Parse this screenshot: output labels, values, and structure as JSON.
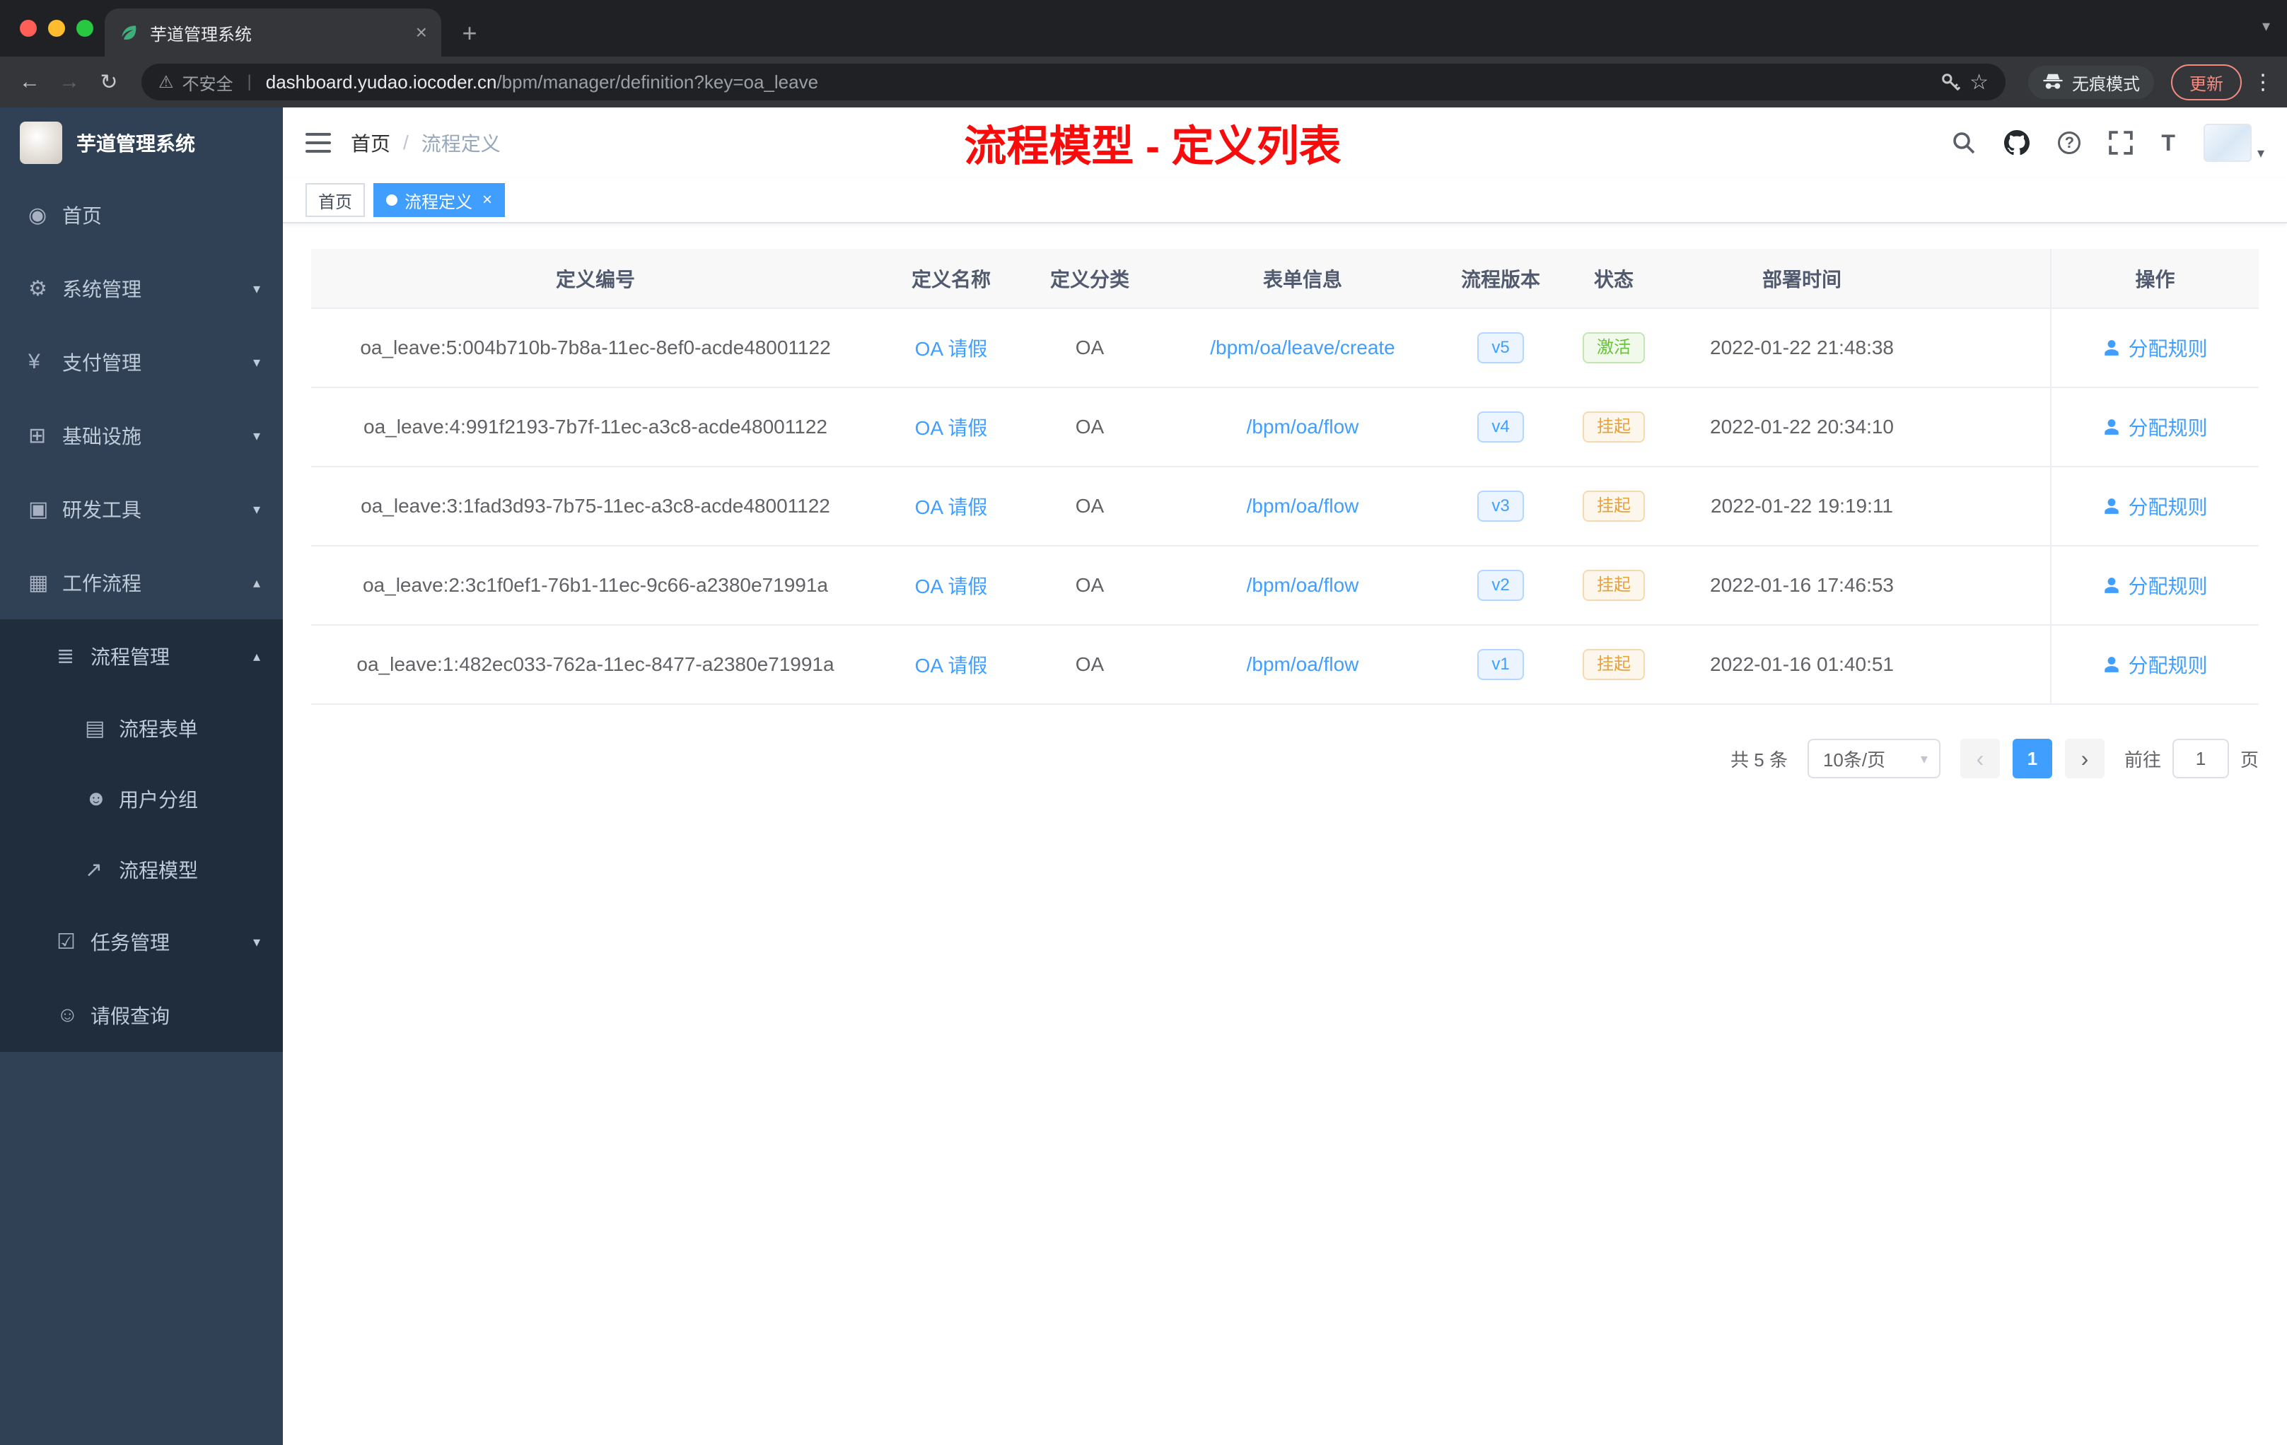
{
  "colors": {
    "accent": "#409eff",
    "annotation": "#f70b0b",
    "success": "#67c23a",
    "warning": "#e6a23c"
  },
  "icons": {
    "back": "←",
    "forward": "→",
    "reload": "↻",
    "warning": "⚠",
    "star": "☆",
    "dots": "⋮",
    "plus": "+",
    "close": "×",
    "caret_down": "▾",
    "caret_up": "▴",
    "divider": "|",
    "dashboard": "◉",
    "gear": "⚙",
    "payment": "¥",
    "infrastructure": "⊞",
    "devtools": "▣",
    "workflow": "▦",
    "process_management": "≣",
    "form": "▤",
    "user_group": "☻",
    "process_model": "↗",
    "task": "☑",
    "leave_query": "☺",
    "font_size": "T",
    "prev": "‹",
    "next": "›",
    "question": "?"
  },
  "browser": {
    "tab": {
      "title": "芋道管理系统"
    },
    "toolbar": {
      "security_label": "不安全",
      "url_domain": "dashboard.yudao.iocoder.cn",
      "url_path": "/bpm/manager/definition?key=oa_leave",
      "incognito_label": "无痕模式",
      "update_label": "更新"
    }
  },
  "sidebar": {
    "logo_title": "芋道管理系统",
    "items": [
      {
        "label": "首页"
      },
      {
        "label": "系统管理"
      },
      {
        "label": "支付管理"
      },
      {
        "label": "基础设施"
      },
      {
        "label": "研发工具"
      },
      {
        "label": "工作流程"
      },
      {
        "label": "流程管理"
      },
      {
        "label": "流程表单"
      },
      {
        "label": "用户分组"
      },
      {
        "label": "流程模型"
      },
      {
        "label": "任务管理"
      },
      {
        "label": "请假查询"
      }
    ]
  },
  "header": {
    "breadcrumb": {
      "home": "首页",
      "separator": "/",
      "current": "流程定义"
    },
    "annotation": "流程模型 - 定义列表"
  },
  "tags": {
    "items": [
      {
        "label": "首页"
      },
      {
        "label": "流程定义"
      }
    ]
  },
  "table": {
    "columns": [
      "定义编号",
      "定义名称",
      "定义分类",
      "表单信息",
      "流程版本",
      "状态",
      "部署时间",
      "操作"
    ],
    "rows": [
      {
        "id": "oa_leave:5:004b710b-7b8a-11ec-8ef0-acde48001122",
        "name": "OA 请假",
        "category": "OA",
        "form": "/bpm/oa/leave/create",
        "version": "v5",
        "status": "激活",
        "status_type": "success",
        "time": "2022-01-22 21:48:38",
        "action": "分配规则"
      },
      {
        "id": "oa_leave:4:991f2193-7b7f-11ec-a3c8-acde48001122",
        "name": "OA 请假",
        "category": "OA",
        "form": "/bpm/oa/flow",
        "version": "v4",
        "status": "挂起",
        "status_type": "warning",
        "time": "2022-01-22 20:34:10",
        "action": "分配规则"
      },
      {
        "id": "oa_leave:3:1fad3d93-7b75-11ec-a3c8-acde48001122",
        "name": "OA 请假",
        "category": "OA",
        "form": "/bpm/oa/flow",
        "version": "v3",
        "status": "挂起",
        "status_type": "warning",
        "time": "2022-01-22 19:19:11",
        "action": "分配规则"
      },
      {
        "id": "oa_leave:2:3c1f0ef1-76b1-11ec-9c66-a2380e71991a",
        "name": "OA 请假",
        "category": "OA",
        "form": "/bpm/oa/flow",
        "version": "v2",
        "status": "挂起",
        "status_type": "warning",
        "time": "2022-01-16 17:46:53",
        "action": "分配规则"
      },
      {
        "id": "oa_leave:1:482ec033-762a-11ec-8477-a2380e71991a",
        "name": "OA 请假",
        "category": "OA",
        "form": "/bpm/oa/flow",
        "version": "v1",
        "status": "挂起",
        "status_type": "warning",
        "time": "2022-01-16 01:40:51",
        "action": "分配规则"
      }
    ]
  },
  "pagination": {
    "total": "共 5 条",
    "page_size": "10条/页",
    "current_page": "1",
    "goto_label": "前往",
    "goto_value": "1",
    "page_unit": "页"
  }
}
